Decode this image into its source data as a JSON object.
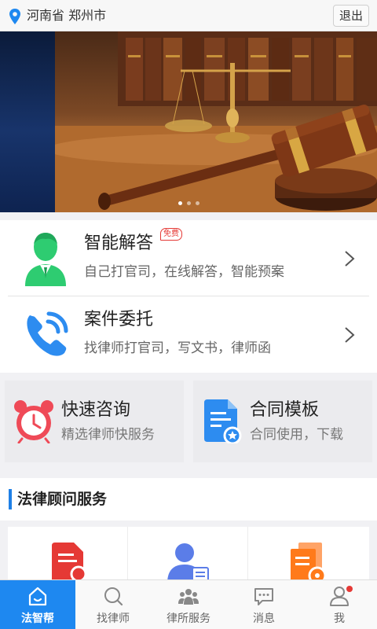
{
  "header": {
    "location": "河南省 郑州市",
    "logout_label": "退出"
  },
  "banner": {
    "image": "judge-gavel-and-scales",
    "slides_count": 3,
    "active_slide": 1
  },
  "features": [
    {
      "title": "智能解答",
      "badge": "免费",
      "subtitle": "自己打官司，在线解答，智能预案",
      "icon": "lawyer-avatar-icon"
    },
    {
      "title": "案件委托",
      "subtitle": "找律师打官司，写文书，律师函",
      "icon": "phone-call-icon"
    }
  ],
  "quick": [
    {
      "title": "快速咨询",
      "subtitle": "精选律师快服务",
      "icon": "alarm-clock-icon"
    },
    {
      "title": "合同模板",
      "subtitle": "合同使用，下载",
      "icon": "contract-document-icon"
    }
  ],
  "section": {
    "title": "法律顾问服务"
  },
  "services": [
    {
      "icon": "red-document-icon"
    },
    {
      "icon": "consultant-person-icon"
    },
    {
      "icon": "orange-files-gear-icon"
    }
  ],
  "nav": [
    {
      "label": "法智帮",
      "icon": "home-icon",
      "active": true
    },
    {
      "label": "找律师",
      "icon": "search-icon",
      "active": false
    },
    {
      "label": "律所服务",
      "icon": "group-icon",
      "active": false
    },
    {
      "label": "消息",
      "icon": "message-icon",
      "active": false
    },
    {
      "label": "我",
      "icon": "user-icon",
      "active": false,
      "notification": true
    }
  ],
  "colors": {
    "accent": "#1e88f0",
    "badge": "#e53935",
    "green": "#2ecc71",
    "blue": "#2d8cf0",
    "red": "#e53935",
    "orange": "#ff7a1a"
  }
}
